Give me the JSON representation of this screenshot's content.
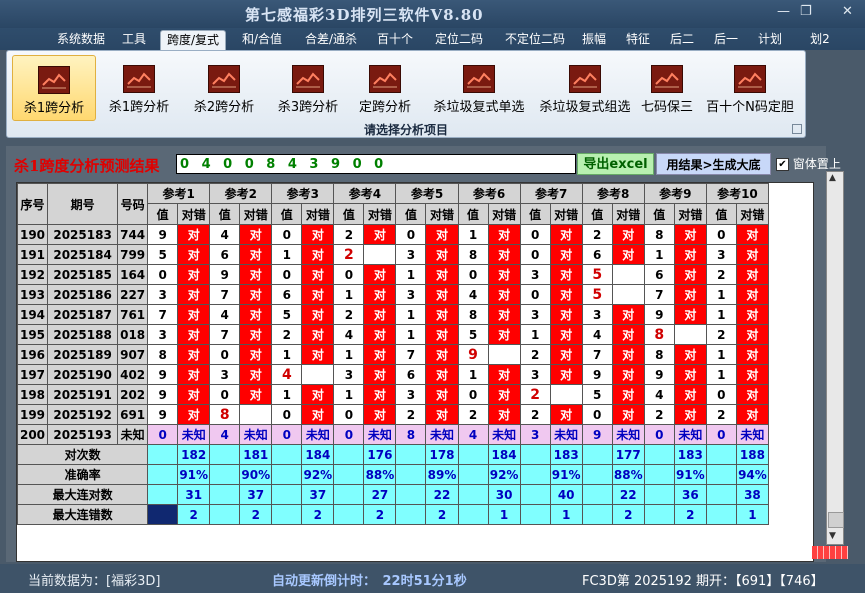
{
  "window": {
    "title": "第七感福彩3D排列三软件V8.80",
    "minimize": "—",
    "restore": "❐",
    "close": "✕"
  },
  "menu": [
    "系统数据",
    "工具",
    "跨度/复式",
    "和/合值",
    "合差/通杀",
    "百十个",
    "定位二码",
    "不定位二码",
    "振幅",
    "特征",
    "后二",
    "后一",
    "计划",
    "划2"
  ],
  "ribbon": {
    "buttons": [
      "杀1跨分析",
      "杀1跨分析",
      "杀2跨分析",
      "杀3跨分析",
      "定跨分析",
      "杀垃圾复式单选",
      "杀垃圾复式组选",
      "七码保三",
      "百十个N码定胆"
    ],
    "caption": "请选择分析项目",
    "icon": "chart-icon"
  },
  "result": {
    "title": "杀1跨度分析预测结果",
    "value": "0 4 0 0 8 4 3 9 0 0",
    "export_label": "导出excel",
    "gen_label": "用结果>生成大底",
    "pin_label": "窗体置上",
    "pin_checked": "✔"
  },
  "table": {
    "col_seq": "序号",
    "col_issue": "期号",
    "col_num": "号码",
    "refs": [
      "参考1",
      "参考2",
      "参考3",
      "参考4",
      "参考5",
      "参考6",
      "参考7",
      "参考8",
      "参考9",
      "参考10"
    ],
    "sub_val": "值",
    "sub_dc": "对错",
    "rows": [
      {
        "seq": "190",
        "issue": "2025183",
        "num": "744",
        "cells": [
          [
            "9",
            "对"
          ],
          [
            "4",
            "对"
          ],
          [
            "0",
            "对"
          ],
          [
            "2",
            "对"
          ],
          [
            "0",
            "对"
          ],
          [
            "1",
            "对"
          ],
          [
            "0",
            "对"
          ],
          [
            "2",
            "对"
          ],
          [
            "8",
            "对"
          ],
          [
            "0",
            "对"
          ]
        ]
      },
      {
        "seq": "191",
        "issue": "2025184",
        "num": "799",
        "cells": [
          [
            "5",
            "对"
          ],
          [
            "6",
            "对"
          ],
          [
            "1",
            "对"
          ],
          [
            "2",
            "!"
          ],
          [
            "3",
            "对"
          ],
          [
            "8",
            "对"
          ],
          [
            "0",
            "对"
          ],
          [
            "6",
            "对"
          ],
          [
            "1",
            "对"
          ],
          [
            "3",
            "对"
          ]
        ]
      },
      {
        "seq": "192",
        "issue": "2025185",
        "num": "164",
        "cells": [
          [
            "0",
            "对"
          ],
          [
            "9",
            "对"
          ],
          [
            "0",
            "对"
          ],
          [
            "0",
            "对"
          ],
          [
            "1",
            "对"
          ],
          [
            "0",
            "对"
          ],
          [
            "3",
            "对"
          ],
          [
            "5",
            "!"
          ],
          [
            "6",
            "对"
          ],
          [
            "2",
            "对"
          ]
        ]
      },
      {
        "seq": "193",
        "issue": "2025186",
        "num": "227",
        "cells": [
          [
            "3",
            "对"
          ],
          [
            "7",
            "对"
          ],
          [
            "6",
            "对"
          ],
          [
            "1",
            "对"
          ],
          [
            "3",
            "对"
          ],
          [
            "4",
            "对"
          ],
          [
            "0",
            "对"
          ],
          [
            "5",
            "!"
          ],
          [
            "7",
            "对"
          ],
          [
            "1",
            "对"
          ]
        ]
      },
      {
        "seq": "194",
        "issue": "2025187",
        "num": "761",
        "cells": [
          [
            "7",
            "对"
          ],
          [
            "4",
            "对"
          ],
          [
            "5",
            "对"
          ],
          [
            "2",
            "对"
          ],
          [
            "1",
            "对"
          ],
          [
            "8",
            "对"
          ],
          [
            "3",
            "对"
          ],
          [
            "3",
            "对"
          ],
          [
            "9",
            "对"
          ],
          [
            "1",
            "对"
          ]
        ]
      },
      {
        "seq": "195",
        "issue": "2025188",
        "num": "018",
        "cells": [
          [
            "3",
            "对"
          ],
          [
            "7",
            "对"
          ],
          [
            "2",
            "对"
          ],
          [
            "4",
            "对"
          ],
          [
            "1",
            "对"
          ],
          [
            "5",
            "对"
          ],
          [
            "1",
            "对"
          ],
          [
            "4",
            "对"
          ],
          [
            "8",
            "!"
          ],
          [
            "2",
            "对"
          ]
        ]
      },
      {
        "seq": "196",
        "issue": "2025189",
        "num": "907",
        "cells": [
          [
            "8",
            "对"
          ],
          [
            "0",
            "对"
          ],
          [
            "1",
            "对"
          ],
          [
            "1",
            "对"
          ],
          [
            "7",
            "对"
          ],
          [
            "9",
            "!"
          ],
          [
            "2",
            "对"
          ],
          [
            "7",
            "对"
          ],
          [
            "8",
            "对"
          ],
          [
            "1",
            "对"
          ]
        ]
      },
      {
        "seq": "197",
        "issue": "2025190",
        "num": "402",
        "cells": [
          [
            "9",
            "对"
          ],
          [
            "3",
            "对"
          ],
          [
            "4",
            "!"
          ],
          [
            "3",
            "对"
          ],
          [
            "6",
            "对"
          ],
          [
            "1",
            "对"
          ],
          [
            "3",
            "对"
          ],
          [
            "9",
            "对"
          ],
          [
            "9",
            "对"
          ],
          [
            "1",
            "对"
          ]
        ]
      },
      {
        "seq": "198",
        "issue": "2025191",
        "num": "202",
        "cells": [
          [
            "9",
            "对"
          ],
          [
            "0",
            "对"
          ],
          [
            "1",
            "对"
          ],
          [
            "1",
            "对"
          ],
          [
            "3",
            "对"
          ],
          [
            "0",
            "对"
          ],
          [
            "2",
            "!"
          ],
          [
            "5",
            "对"
          ],
          [
            "4",
            "对"
          ],
          [
            "0",
            "对"
          ]
        ]
      },
      {
        "seq": "199",
        "issue": "2025192",
        "num": "691",
        "cells": [
          [
            "9",
            "对"
          ],
          [
            "8",
            "!"
          ],
          [
            "0",
            "对"
          ],
          [
            "0",
            "对"
          ],
          [
            "2",
            "对"
          ],
          [
            "2",
            "对"
          ],
          [
            "2",
            "对"
          ],
          [
            "0",
            "对"
          ],
          [
            "2",
            "对"
          ],
          [
            "2",
            "对"
          ]
        ]
      }
    ],
    "pending": {
      "seq": "200",
      "issue": "2025193",
      "num": "未知",
      "cells": [
        [
          "0",
          "未知"
        ],
        [
          "4",
          "未知"
        ],
        [
          "0",
          "未知"
        ],
        [
          "0",
          "未知"
        ],
        [
          "8",
          "未知"
        ],
        [
          "4",
          "未知"
        ],
        [
          "3",
          "未知"
        ],
        [
          "9",
          "未知"
        ],
        [
          "0",
          "未知"
        ],
        [
          "0",
          "未知"
        ]
      ]
    },
    "stats": [
      {
        "label": "对次数",
        "values": [
          "182",
          "181",
          "184",
          "176",
          "178",
          "184",
          "183",
          "177",
          "183",
          "188"
        ]
      },
      {
        "label": "准确率",
        "values": [
          "91%",
          "90%",
          "92%",
          "88%",
          "89%",
          "92%",
          "91%",
          "88%",
          "91%",
          "94%"
        ]
      },
      {
        "label": "最大连对数",
        "values": [
          "31",
          "37",
          "37",
          "27",
          "22",
          "30",
          "40",
          "22",
          "36",
          "38"
        ]
      },
      {
        "label": "最大连错数",
        "values": [
          "2",
          "2",
          "2",
          "2",
          "2",
          "1",
          "1",
          "2",
          "2",
          "1"
        ]
      }
    ]
  },
  "status": {
    "data_source": "当前数据为：[福彩3D]",
    "countdown": "自动更新倒计时：　22时51分1秒",
    "draw": "FC3D第 2025192 期开：【691】【746】"
  }
}
